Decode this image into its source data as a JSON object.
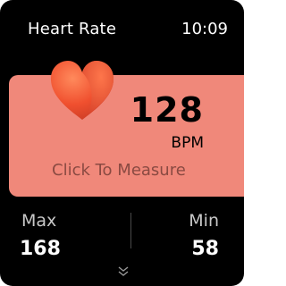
{
  "header": {
    "title": "Heart Rate",
    "time": "10:09"
  },
  "reading": {
    "value": "128",
    "unit": "BPM",
    "action_label": "Click To Measure"
  },
  "stats": {
    "max_label": "Max",
    "max_value": "168",
    "min_label": "Min",
    "min_value": "58"
  },
  "icons": {
    "heart": "heart-icon",
    "more": "chevron-down-double-icon"
  },
  "colors": {
    "card": "#f0887a",
    "heart": "#ee4f2f",
    "measure_text": "#8a4a42"
  }
}
